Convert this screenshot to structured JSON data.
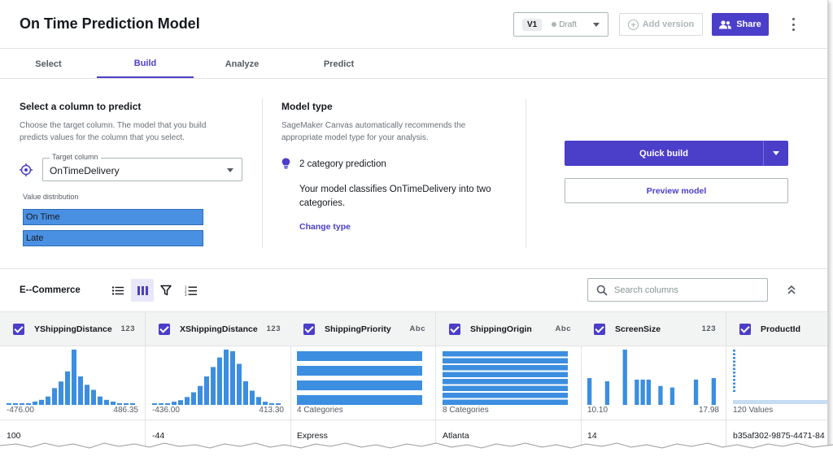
{
  "header": {
    "title": "On Time Prediction Model",
    "version_label": "V1",
    "version_status": "Draft",
    "add_version_label": "Add version",
    "share_label": "Share"
  },
  "tabs": [
    {
      "label": "Select",
      "active": false
    },
    {
      "label": "Build",
      "active": true
    },
    {
      "label": "Analyze",
      "active": false
    },
    {
      "label": "Predict",
      "active": false
    }
  ],
  "target": {
    "heading": "Select a column to predict",
    "description_line1": "Choose the target column. The model that you build",
    "description_line2": "predicts values for the column that you select.",
    "field_label": "Target column",
    "field_value": "OnTimeDelivery",
    "distribution_label": "Value distribution",
    "distribution": [
      {
        "label": "On Time",
        "fraction": 1.0
      },
      {
        "label": "Late",
        "fraction": 1.0
      }
    ]
  },
  "model_type": {
    "heading": "Model type",
    "description_line1": "SageMaker Canvas automatically recommends the",
    "description_line2": "appropriate model type for your analysis.",
    "prediction": "2 category prediction",
    "explanation_line1": "Your model classifies OnTimeDelivery into two",
    "explanation_line2": "categories.",
    "change_label": "Change type"
  },
  "actions": {
    "quick_build_label": "Quick build",
    "preview_label": "Preview model"
  },
  "dataset": {
    "name": "E--Commerce",
    "search_placeholder": "Search columns"
  },
  "columns": [
    {
      "name": "YShippingDistance",
      "type": "123",
      "summary_left": "-476.00",
      "summary_right": "486.35",
      "value": "100",
      "chart": "histogram",
      "bins": [
        1,
        1,
        1,
        1,
        2,
        3,
        5,
        10,
        14,
        20,
        33,
        17,
        12,
        9,
        5,
        3,
        2,
        1,
        1,
        1
      ]
    },
    {
      "name": "XShippingDistance",
      "type": "123",
      "summary_left": "-436.00",
      "summary_right": "413.30",
      "value": "-44",
      "chart": "histogram",
      "bins": [
        1,
        1,
        1,
        2,
        3,
        5,
        8,
        12,
        18,
        24,
        30,
        35,
        34,
        26,
        15,
        9,
        5,
        2,
        1,
        1
      ]
    },
    {
      "name": "ShippingPriority",
      "type": "Abc",
      "summary_left": "4 Categories",
      "summary_right": "",
      "value": "Express",
      "chart": "categories",
      "bars": [
        1,
        1,
        1,
        1
      ]
    },
    {
      "name": "ShippingOrigin",
      "type": "Abc",
      "summary_left": "8 Categories",
      "summary_right": "",
      "value": "Atlanta",
      "chart": "categories",
      "bars": [
        1,
        1,
        1,
        1,
        1,
        1,
        1,
        1
      ]
    },
    {
      "name": "ScreenSize",
      "type": "123",
      "summary_left": "10.10",
      "summary_right": "17.98",
      "value": "14",
      "chart": "histogram",
      "bins": [
        17,
        0,
        0,
        15,
        0,
        0,
        35,
        0,
        16,
        16,
        16,
        0,
        12,
        0,
        11,
        0,
        0,
        0,
        16,
        0,
        0,
        17
      ]
    },
    {
      "name": "ProductId",
      "type": "",
      "summary_left": "120 Values",
      "summary_right": "",
      "value": "b35af302-9875-4471-84",
      "chart": "values",
      "bins": []
    }
  ]
}
